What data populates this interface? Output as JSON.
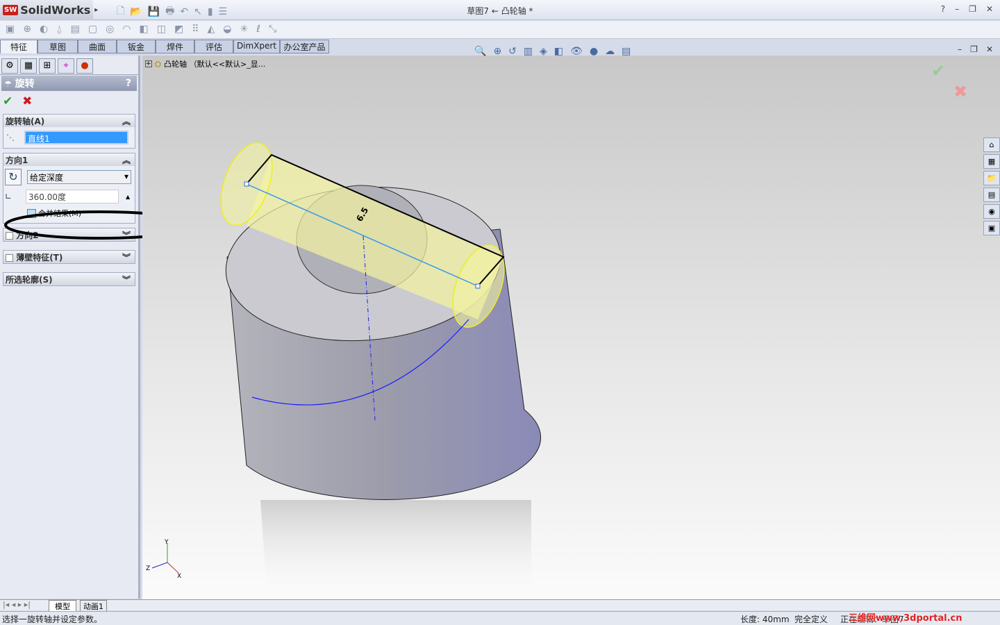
{
  "app": {
    "name": "SolidWorks",
    "title": "草图7 ← 凸轮轴 *",
    "help": "?"
  },
  "tabs": [
    "特征",
    "草图",
    "曲面",
    "钣金",
    "焊件",
    "评估",
    "DimXpert",
    "办公室产品"
  ],
  "tree": {
    "root": "凸轮轴 （默认<<默认>_显..."
  },
  "panel": {
    "title": "旋转",
    "help": "?",
    "axis": {
      "header": "旋转轴(A)",
      "value": "直线1"
    },
    "dir1": {
      "header": "方向1",
      "type": "给定深度",
      "angle": "360.00度",
      "merge_label": "合并结果(M)",
      "merge_checked": false
    },
    "dir2": {
      "header": "方向2",
      "checked": false
    },
    "thin": {
      "header": "薄壁特征(T)",
      "checked": false
    },
    "contours": {
      "header": "所选轮廓(S)"
    }
  },
  "viewport": {
    "dimension": "6.5"
  },
  "bottom_tabs": [
    "模型",
    "动画1"
  ],
  "status": {
    "message": "选择一旋转轴并设定参数。",
    "length": "长度: 40mm",
    "state": "完全定义",
    "editing": "正在编辑：草图7",
    "watermark": "三维网www.3dportal.cn"
  },
  "colors": {
    "accent": "#3399ff",
    "sketch_blue": "#1a1aff",
    "highlight_yellow": "#ffff80"
  }
}
